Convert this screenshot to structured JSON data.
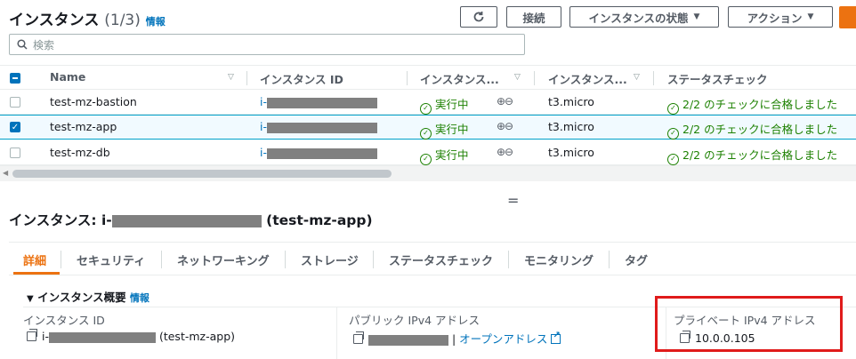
{
  "header": {
    "title": "インスタンス",
    "count": "(1/3)",
    "info": "情報",
    "refresh_icon": "refresh-icon",
    "connect": "接続",
    "instance_state": "インスタンスの状態",
    "actions": "アクション"
  },
  "search": {
    "placeholder": "検索"
  },
  "table": {
    "columns": [
      "Name",
      "インスタンス ID",
      "インスタンス...",
      "インスタンス...",
      "ステータスチェック"
    ],
    "rows": [
      {
        "name": "test-mz-bastion",
        "id_prefix": "i-",
        "state": "実行中",
        "type": "t3.micro",
        "check": "2/2 のチェックに合格しました",
        "selected": false
      },
      {
        "name": "test-mz-app",
        "id_prefix": "i-",
        "state": "実行中",
        "type": "t3.micro",
        "check": "2/2 のチェックに合格しました",
        "selected": true
      },
      {
        "name": "test-mz-db",
        "id_prefix": "i-",
        "state": "実行中",
        "type": "t3.micro",
        "check": "2/2 のチェックに合格しました",
        "selected": false
      }
    ]
  },
  "detail": {
    "title_prefix": "インスタンス: i-",
    "title_suffix": "(test-mz-app)",
    "tabs": [
      "詳細",
      "セキュリティ",
      "ネットワーキング",
      "ストレージ",
      "ステータスチェック",
      "モニタリング",
      "タグ"
    ],
    "section": "インスタンス概要",
    "section_info": "情報",
    "fields": {
      "instance_id_label": "インスタンス ID",
      "instance_id_prefix": "i-",
      "instance_id_suffix": "(test-mz-app)",
      "public_ipv4_label": "パブリック IPv4 アドレス",
      "public_ipv4_link": "オープンアドレス",
      "private_ipv4_label": "プライベート IPv4 アドレス",
      "private_ipv4_value": "10.0.0.105"
    }
  },
  "colors": {
    "accent": "#ec7211",
    "link": "#0073bb",
    "success": "#1d8102",
    "highlight": "#e01b1b"
  }
}
